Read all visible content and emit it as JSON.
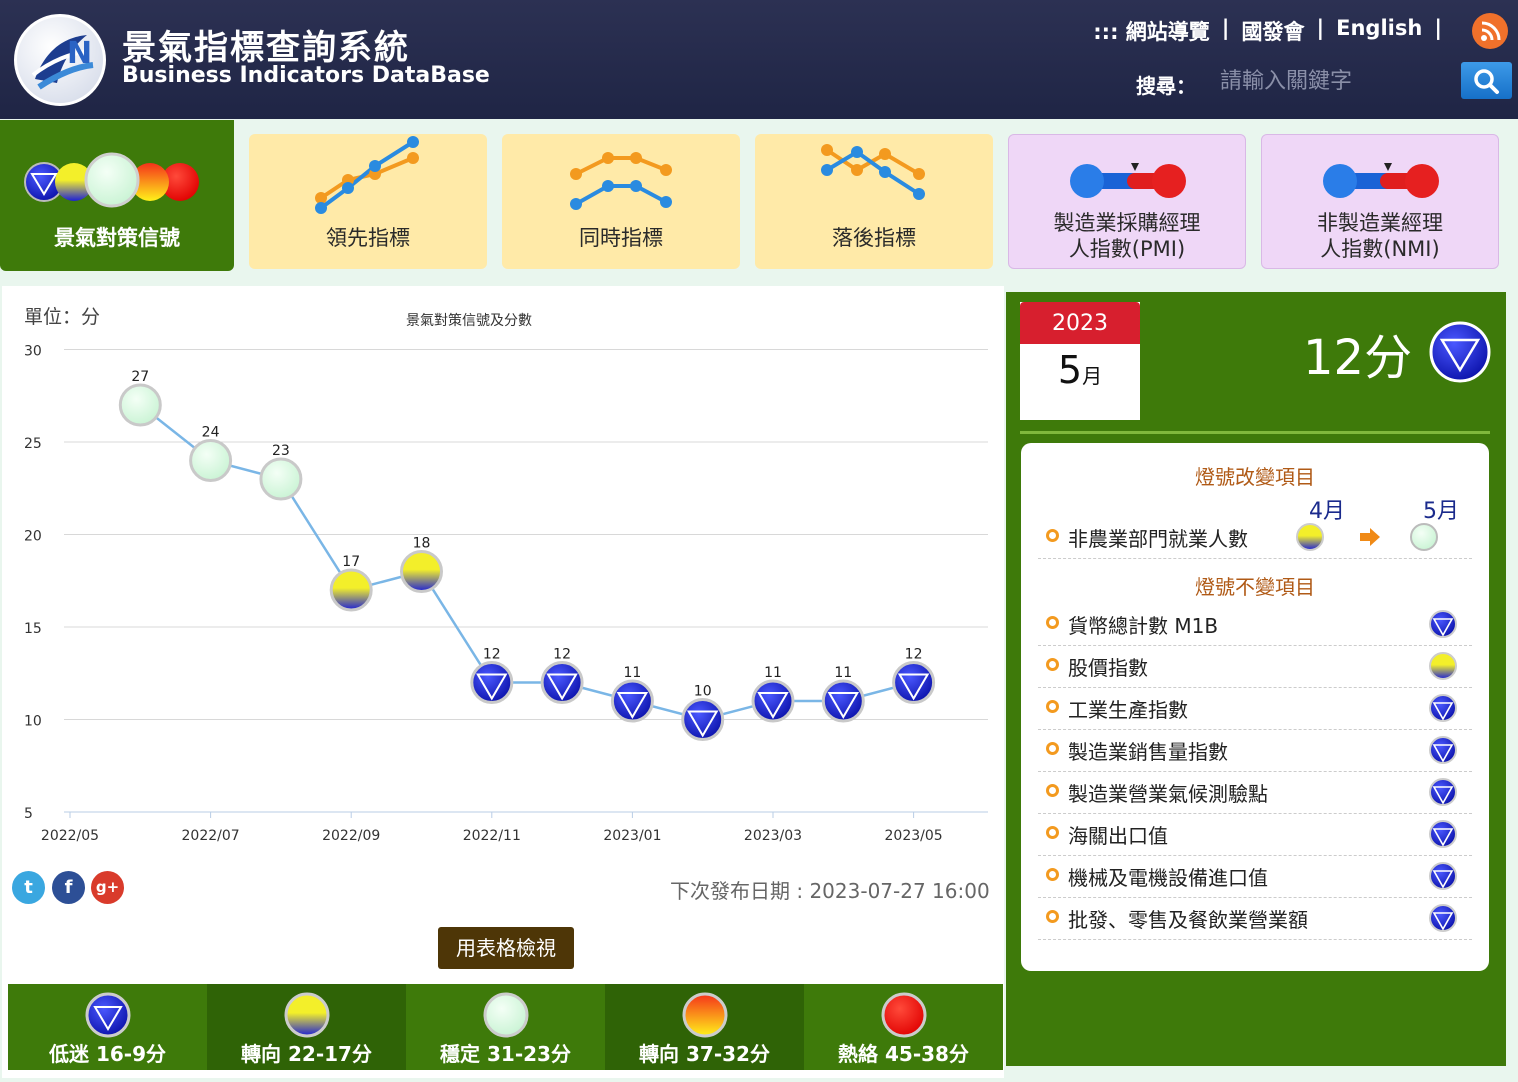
{
  "header": {
    "title_zh": "景氣指標查詢系統",
    "title_en": "Business Indicators DataBase",
    "nav": [
      ":::  網站導覽",
      "國發會",
      "English"
    ],
    "search_label": "搜尋：",
    "search_placeholder": "請輸入關鍵字",
    "rss_icon": "rss-icon",
    "search_icon": "search-icon"
  },
  "tabs": [
    {
      "label": "景氣對策信號",
      "active": true
    },
    {
      "label": "領先指標"
    },
    {
      "label": "同時指標"
    },
    {
      "label": "落後指標"
    },
    {
      "label1": "製造業採購經理",
      "label2": "人指數(PMI)"
    },
    {
      "label1": "非製造業經理",
      "label2": "人指數(NMI)"
    }
  ],
  "chart_panel": {
    "unit": "單位：分",
    "title": "景氣對策信號及分數",
    "next_release": "下次發布日期 : 2023-07-27 16:00",
    "table_button": "用表格檢視"
  },
  "chart_data": {
    "type": "line",
    "title": "景氣對策信號及分數",
    "ylabel": "單位：分",
    "ylim": [
      5,
      30
    ],
    "yticks": [
      5,
      10,
      15,
      20,
      25,
      30
    ],
    "xtick_labels": [
      "2022/05",
      "2022/07",
      "2022/09",
      "2022/11",
      "2023/01",
      "2023/03",
      "2023/05"
    ],
    "points": [
      {
        "x": "2022/06",
        "y": 27,
        "signal": "green"
      },
      {
        "x": "2022/07",
        "y": 24,
        "signal": "green"
      },
      {
        "x": "2022/08",
        "y": 23,
        "signal": "green"
      },
      {
        "x": "2022/09",
        "y": 17,
        "signal": "yellow-blue"
      },
      {
        "x": "2022/10",
        "y": 18,
        "signal": "yellow-blue"
      },
      {
        "x": "2022/11",
        "y": 12,
        "signal": "blue"
      },
      {
        "x": "2022/12",
        "y": 12,
        "signal": "blue"
      },
      {
        "x": "2023/01",
        "y": 11,
        "signal": "blue"
      },
      {
        "x": "2023/02",
        "y": 10,
        "signal": "blue"
      },
      {
        "x": "2023/03",
        "y": 11,
        "signal": "blue"
      },
      {
        "x": "2023/04",
        "y": 11,
        "signal": "blue"
      },
      {
        "x": "2023/05",
        "y": 12,
        "signal": "blue"
      }
    ],
    "colors": {
      "line": "#7ab6e6",
      "grid": "#d8d8d8"
    }
  },
  "legend": [
    {
      "label": "低迷 16-9分",
      "signal": "blue"
    },
    {
      "label": "轉向 22-17分",
      "signal": "yellow-blue"
    },
    {
      "label": "穩定 31-23分",
      "signal": "green"
    },
    {
      "label": "轉向 37-32分",
      "signal": "yellow-red"
    },
    {
      "label": "熱絡 45-38分",
      "signal": "red"
    }
  ],
  "current": {
    "year": "2023",
    "month_num": "5",
    "month_unit": "月",
    "score": "12分",
    "signal": "blue"
  },
  "changes": {
    "changed_title": "燈號改變項目",
    "prev_month": "4月",
    "this_month": "5月",
    "changed_items": [
      {
        "name": "非農業部門就業人數",
        "from": "yellow-blue",
        "to": "green"
      }
    ],
    "unchanged_title": "燈號不變項目",
    "unchanged_items": [
      {
        "name": "貨幣總計數 M1B",
        "signal": "blue"
      },
      {
        "name": "股價指數",
        "signal": "yellow-blue"
      },
      {
        "name": "工業生產指數",
        "signal": "blue"
      },
      {
        "name": "製造業銷售量指數",
        "signal": "blue"
      },
      {
        "name": "製造業營業氣候測驗點",
        "signal": "blue"
      },
      {
        "name": "海關出口值",
        "signal": "blue"
      },
      {
        "name": "機械及電機設備進口值",
        "signal": "blue"
      },
      {
        "name": "批發、零售及餐飲業營業額",
        "signal": "blue"
      }
    ]
  },
  "social": [
    "twitter-icon",
    "facebook-icon",
    "google-plus-icon"
  ]
}
